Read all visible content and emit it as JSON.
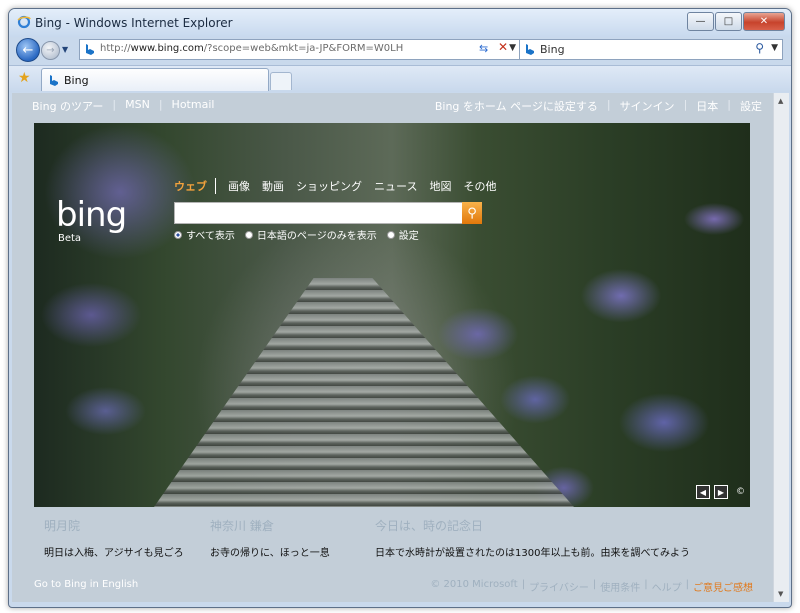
{
  "window": {
    "title": "Bing - Windows Internet Explorer"
  },
  "address": {
    "url_prefix": "http://",
    "url_host": "www.bing.com",
    "url_path": "/?scope=web&mkt=ja-JP&FORM=W0LH"
  },
  "search_provider": {
    "label": "Bing"
  },
  "tab": {
    "label": "Bing"
  },
  "toplinks": {
    "left": [
      "Bing のツアー",
      "MSN",
      "Hotmail"
    ],
    "right": [
      "Bing をホーム ページに設定する",
      "サインイン",
      "日本",
      "設定"
    ]
  },
  "logo": {
    "text": "bing",
    "beta": "Beta"
  },
  "scopes": [
    "ウェブ",
    "画像",
    "動画",
    "ショッピング",
    "ニュース",
    "地図",
    "その他"
  ],
  "search": {
    "query": "",
    "go_icon": "magnifier-icon"
  },
  "radios": [
    {
      "label": "すべて表示",
      "selected": true
    },
    {
      "label": "日本語のページのみを表示",
      "selected": false
    },
    {
      "label": "設定",
      "selected": false
    }
  ],
  "hero_nav": {
    "prev": "◀",
    "next": "▶",
    "copyright": "©"
  },
  "hotspots": [
    {
      "heading": "明月院",
      "desc": "明日は入梅、アジサイも見ごろ"
    },
    {
      "heading": "神奈川 鎌倉",
      "desc": "お寺の帰りに、ほっと一息"
    },
    {
      "heading": "今日は、時の記念日",
      "desc": "日本で水時計が設置されたのは1300年以上も前。由来を調べてみよう"
    }
  ],
  "footer": {
    "left": "Go to Bing in English",
    "right": [
      "© 2010 Microsoft",
      "プライバシー",
      "使用条件",
      "ヘルプ"
    ],
    "feedback": "ご意見ご感想"
  },
  "colors": {
    "accent_orange": "#f3a23c",
    "feedback_orange": "#e07a1e",
    "page_bg": "#c3ced8"
  }
}
